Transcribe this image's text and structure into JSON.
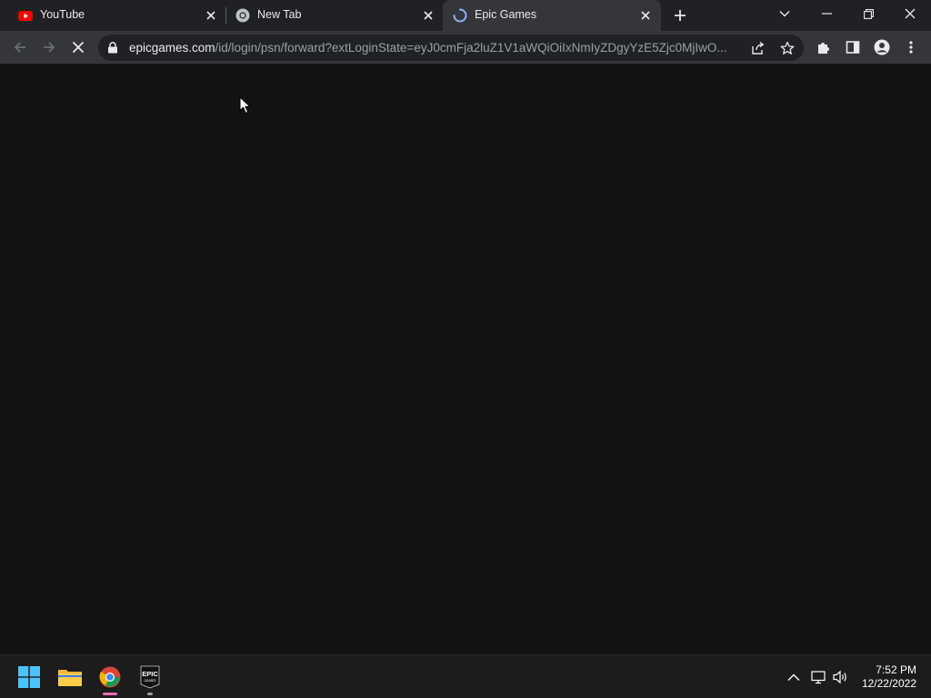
{
  "browser": {
    "tabs": [
      {
        "title": "YouTube",
        "icon": "youtube-icon",
        "active": false
      },
      {
        "title": "New Tab",
        "icon": "chrome-icon",
        "active": false
      },
      {
        "title": "Epic Games",
        "icon": "loading-spinner-icon",
        "active": true
      }
    ],
    "url": {
      "host": "epicgames.com",
      "path": "/id/login/psn/forward?extLoginState=eyJ0cmFja2luZ1V1aWQiOiIxNmIyZDgyYzE5Zjc0MjIwO..."
    }
  },
  "taskbar": {
    "apps": [
      {
        "name": "Start",
        "icon": "windows-start-icon"
      },
      {
        "name": "File Explorer",
        "icon": "file-explorer-icon"
      },
      {
        "name": "Google Chrome",
        "icon": "chrome-icon"
      },
      {
        "name": "Epic Games Launcher",
        "icon": "epic-games-icon",
        "label": "EPIC",
        "sublabel": "GAMES"
      }
    ],
    "time": "7:52 PM",
    "date": "12/22/2022"
  },
  "colors": {
    "tabstrip_bg": "#202124",
    "toolbar_bg": "#35363a",
    "page_bg": "#121212",
    "taskbar_bg": "#1c1c1c",
    "accent_blue": "#8ab4f8"
  }
}
